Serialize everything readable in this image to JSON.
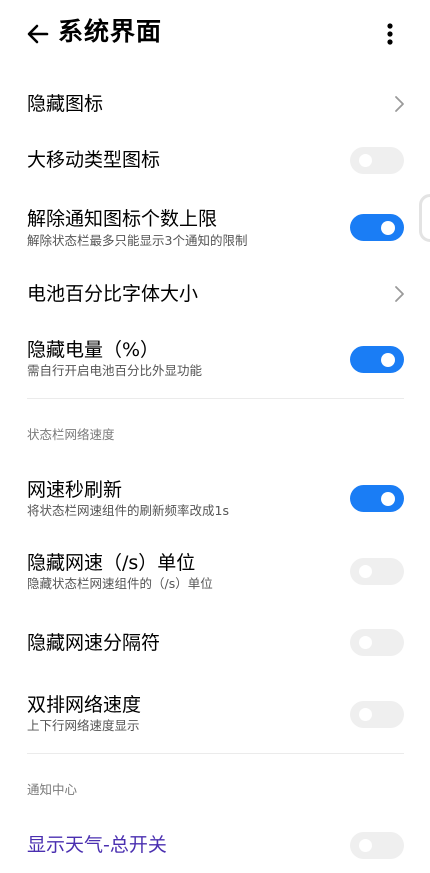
{
  "header": {
    "title": "系统界面",
    "back_icon": "arrow-left-icon",
    "more_icon": "more-vertical-icon"
  },
  "items": [
    {
      "title": "隐藏图标",
      "control": "chevron"
    },
    {
      "title": "大移动类型图标",
      "control": "toggle",
      "on": false
    },
    {
      "title": "解除通知图标个数上限",
      "subtitle": "解除状态栏最多只能显示3个通知的限制",
      "control": "toggle",
      "on": true
    },
    {
      "title": "电池百分比字体大小",
      "control": "chevron"
    },
    {
      "title": "隐藏电量（%）",
      "subtitle": "需自行开启电池百分比外显功能",
      "control": "toggle",
      "on": true
    },
    {
      "title": "网速秒刷新",
      "subtitle": "将状态栏网速组件的刷新频率改成1s",
      "control": "toggle",
      "on": true
    },
    {
      "title": "隐藏网速（/s）单位",
      "subtitle": "隐藏状态栏网速组件的（/s）单位",
      "control": "toggle",
      "on": false
    },
    {
      "title": "隐藏网速分隔符",
      "control": "toggle",
      "on": false
    },
    {
      "title": "双排网络速度",
      "subtitle": "上下行网络速度显示",
      "control": "toggle",
      "on": false
    },
    {
      "title": "显示天气-总开关",
      "control": "toggle",
      "on": false
    }
  ],
  "sections": {
    "statusbar_speed": "状态栏网络速度",
    "notification_center": "通知中心"
  },
  "colors": {
    "toggle_on": "#1a7df5",
    "toggle_off": "#efefef",
    "accent_title": "#4a2fb0"
  }
}
